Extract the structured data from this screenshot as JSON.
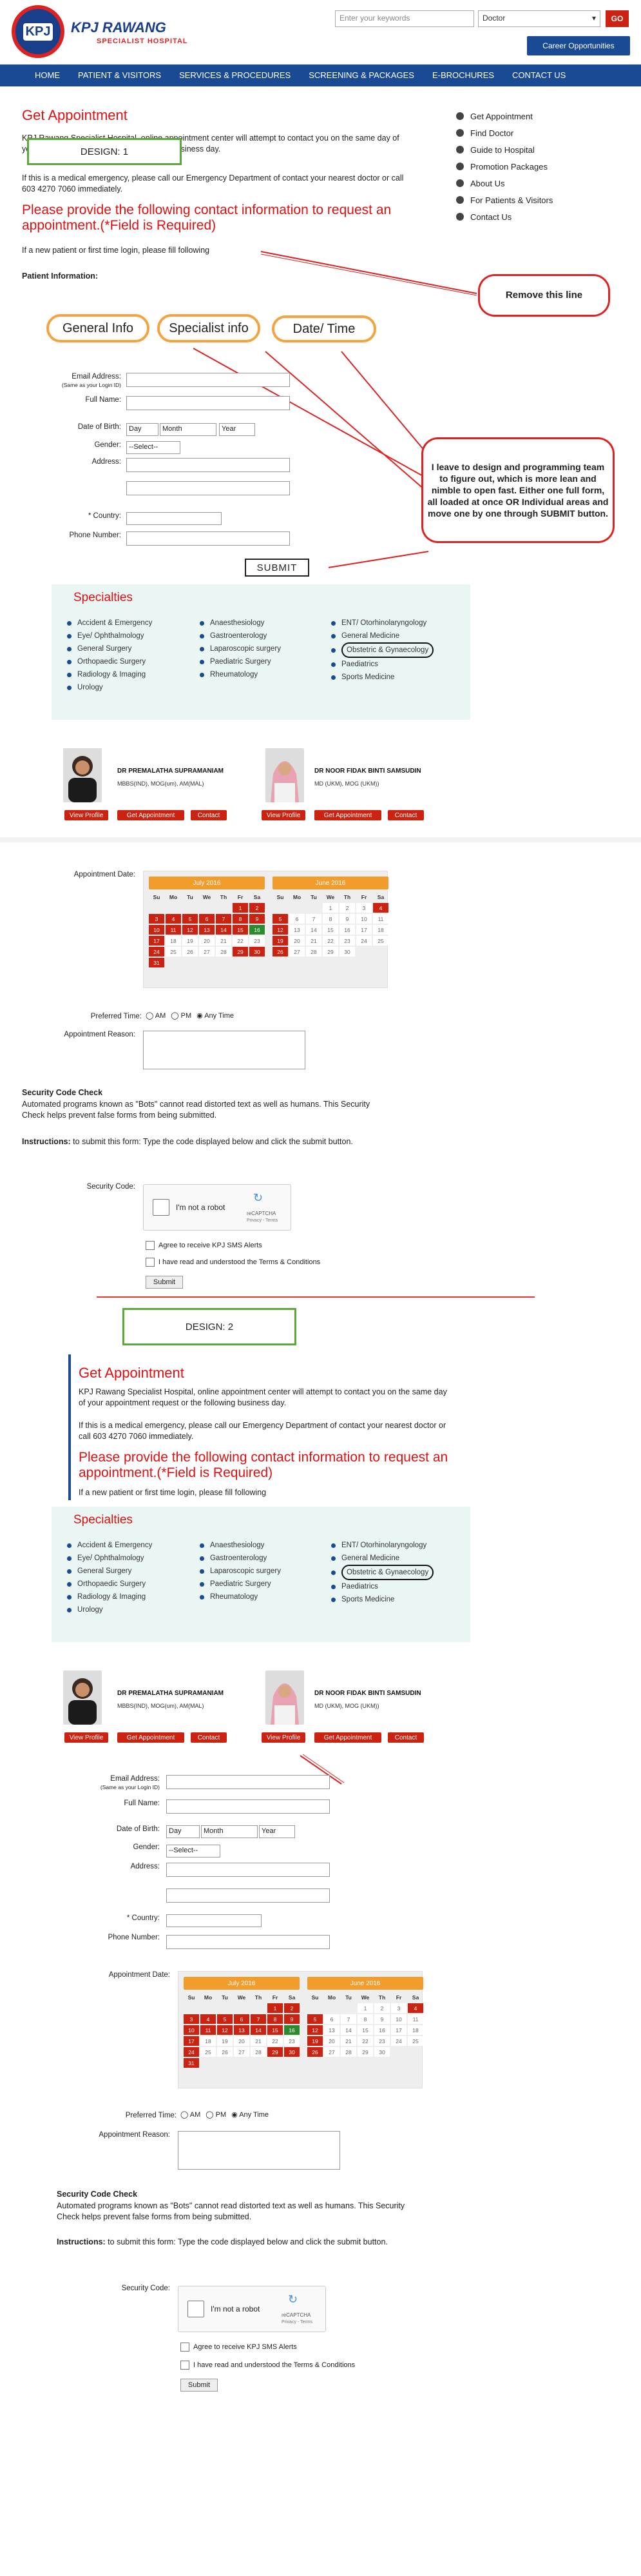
{
  "header": {
    "brand": "KPJ RAWANG",
    "brand_sub": "SPECIALIST HOSPITAL",
    "logo_text": "KPJ",
    "search_placeholder": "Enter your keywords",
    "search_select": "Doctor",
    "go": "GO",
    "career": "Career Opportunities"
  },
  "nav": [
    "HOME",
    "PATIENT & VISITORS",
    "SERVICES & PROCEDURES",
    "SCREENING & PACKAGES",
    "E-BROCHURES",
    "CONTACT US"
  ],
  "sidebar": [
    "Get Appointment",
    "Find Doctor",
    "Guide to Hospital",
    "Promotion Packages",
    "About Us",
    "For Patients & Visitors",
    "Contact Us"
  ],
  "d1": {
    "title": "Get Appointment",
    "design_label": "DESIGN: 1",
    "intro": "KPJ Rawang Specialist Hospital, online appointment center will attempt to contact you on the same day of your appointment request or the following business day.",
    "emergency": "If this is a medical emergency, please call our Emergency Department of contact your nearest doctor or call 603 4270 7060 immediately.",
    "provide": "Please provide the following contact information to request an appointment.(*Field is Required)",
    "newpatient": "If a new patient or first time login, please fill following",
    "patient_info": "Patient Information:",
    "remove_callout": "Remove this line",
    "tabs": [
      "General Info",
      "Specialist info",
      "Date/ Time"
    ],
    "fields": {
      "email": "Email Address:",
      "email_note": "(Same as your Login ID)",
      "name": "Full Name:",
      "dob": "Date of Birth:",
      "gender": "Gender:",
      "address": "Address:",
      "country": "* Country:",
      "phone": "Phone Number:"
    },
    "dob": {
      "day": "Day",
      "month": "Month",
      "year": "Year"
    },
    "gender_opt": "--Select--",
    "leave_callout": "I leave to design and programming team to figure out, which is more lean and nimble to open fast. Either one full form, all loaded at once OR Individual areas and move one by one through SUBMIT button.",
    "submit": "SUBMIT"
  },
  "specialties": {
    "title": "Specialties",
    "col1": [
      "Accident & Emergency",
      "Eye/ Ophthalmology",
      "General Surgery",
      "Orthopaedic Surgery",
      "Radiology & Imaging",
      "Urology"
    ],
    "col2": [
      "Anaesthesiology",
      "Gastroenterology",
      "Laparoscopic surgery",
      "Paediatric Surgery",
      "Rheumatology"
    ],
    "col3": [
      "ENT/ Otorhinolaryngology",
      "General Medicine",
      "Obstetric & Gynaecology",
      "Paediatrics",
      "Sports Medicine"
    ]
  },
  "doctors": [
    {
      "name": "DR PREMALATHA SUPRAMANIAM",
      "qual": "MBBS(IND), MOG(um), AM(MAL)"
    },
    {
      "name": "DR NOOR FIDAK BINTI SAMSUDIN",
      "qual": "MD (UKM), MOG (UKM))"
    }
  ],
  "doc_buttons": [
    "View Profile",
    "Get Appointment",
    "Contact"
  ],
  "form2": {
    "appt_date": "Appointment Date:",
    "months": [
      "July 2016",
      "June 2016"
    ],
    "weekdays": [
      "Su",
      "Mo",
      "Tu",
      "We",
      "Th",
      "Fr",
      "Sa"
    ],
    "pref_time": "Preferred Time:",
    "times": [
      "AM",
      "PM",
      "Any Time"
    ],
    "reason": "Appointment Reason:",
    "sec_title": "Security Code Check",
    "sec_text": "Automated programs known as \"Bots\" cannot read distorted text as well as humans. This Security Check helps prevent false forms from being submitted.",
    "instr_b": "Instructions:",
    "instr": " to submit this form: Type the code displayed below and click the submit button.",
    "sec_code": "Security Code:",
    "robot": "I'm not a robot",
    "recaptcha": "reCAPTCHA",
    "privacy": "Privacy - Terms",
    "sms": "Agree to receive KPJ SMS Alerts",
    "terms": "I have read and understood the Terms & Conditions",
    "submit": "Submit"
  },
  "d2": {
    "design_label": "DESIGN: 2"
  },
  "calendar": {
    "left": [
      "",
      "",
      "",
      "",
      "",
      "1",
      "2",
      "3",
      "4",
      "5",
      "6",
      "7",
      "8",
      "9",
      "10",
      "11",
      "12",
      "13",
      "14",
      "15",
      "16",
      "17",
      "18",
      "19",
      "20",
      "21",
      "22",
      "23",
      "24",
      "25",
      "26",
      "27",
      "28",
      "29",
      "30",
      "31",
      "",
      "",
      "",
      "",
      "",
      ""
    ],
    "left_red": [
      "1",
      "2",
      "3",
      "4",
      "5",
      "6",
      "7",
      "8",
      "9",
      "10",
      "11",
      "12",
      "13",
      "14",
      "15",
      "17",
      "24",
      "29",
      "30",
      "31"
    ],
    "left_green": [
      "16"
    ],
    "right": [
      "",
      "",
      "",
      "1",
      "2",
      "3",
      "4",
      "5",
      "6",
      "7",
      "8",
      "9",
      "10",
      "11",
      "12",
      "13",
      "14",
      "15",
      "16",
      "17",
      "18",
      "19",
      "20",
      "21",
      "22",
      "23",
      "24",
      "25",
      "26",
      "27",
      "28",
      "29",
      "30",
      "",
      "",
      "",
      "",
      "",
      "",
      "",
      "",
      ""
    ],
    "right_red": [
      "4",
      "5",
      "12",
      "19",
      "26"
    ]
  }
}
